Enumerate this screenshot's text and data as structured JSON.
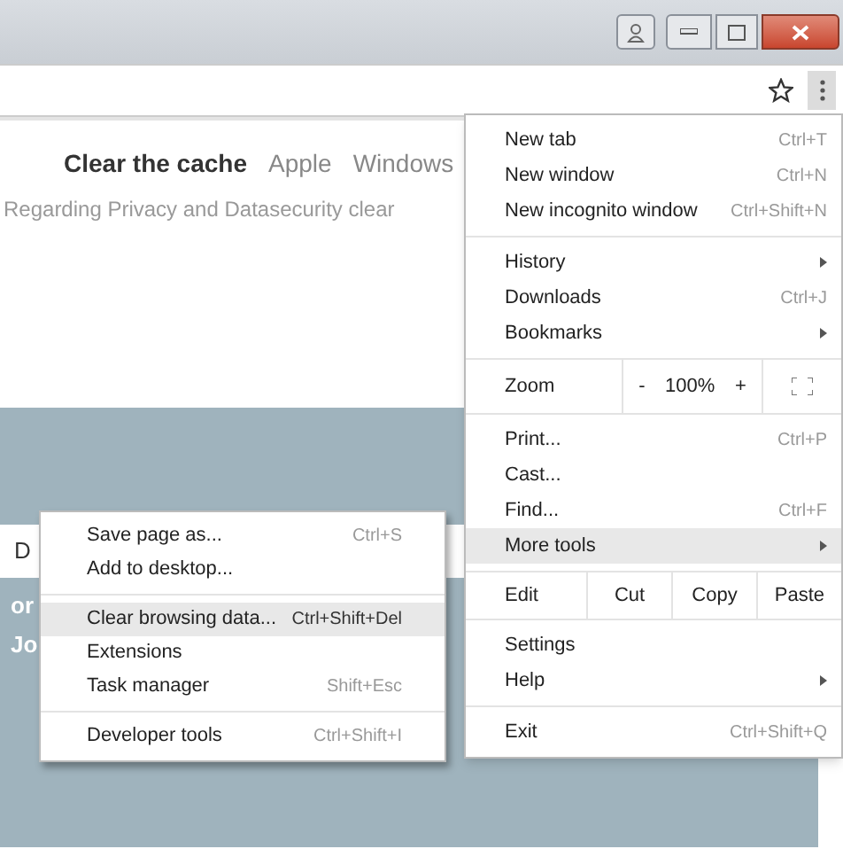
{
  "page": {
    "nav_links": [
      {
        "label": "Clear the cache",
        "selected": true
      },
      {
        "label": "Apple",
        "selected": false
      },
      {
        "label": "Windows",
        "selected": false
      }
    ],
    "subtitle": "Regarding Privacy and Datasecurity clear",
    "fragments": [
      {
        "kind": "strip",
        "text": "D"
      },
      {
        "kind": "banner",
        "text": "or"
      },
      {
        "kind": "banner",
        "text": "Jo"
      }
    ]
  },
  "menu": {
    "sections": [
      [
        {
          "kind": "item",
          "label": "New tab",
          "shortcut": "Ctrl+T",
          "submenu": false,
          "selected": false
        },
        {
          "kind": "item",
          "label": "New window",
          "shortcut": "Ctrl+N",
          "submenu": false,
          "selected": false
        },
        {
          "kind": "item",
          "label": "New incognito window",
          "shortcut": "Ctrl+Shift+N",
          "submenu": false,
          "selected": false
        }
      ],
      [
        {
          "kind": "item",
          "label": "History",
          "submenu": true,
          "selected": false
        },
        {
          "kind": "item",
          "label": "Downloads",
          "shortcut": "Ctrl+J",
          "submenu": false,
          "selected": false
        },
        {
          "kind": "item",
          "label": "Bookmarks",
          "submenu": true,
          "selected": false
        }
      ],
      [
        {
          "kind": "zoom",
          "label": "Zoom",
          "minus": "-",
          "value": "100%",
          "plus": "+"
        }
      ],
      [
        {
          "kind": "item",
          "label": "Print...",
          "shortcut": "Ctrl+P",
          "submenu": false,
          "selected": false
        },
        {
          "kind": "item",
          "label": "Cast...",
          "submenu": false,
          "selected": false
        },
        {
          "kind": "item",
          "label": "Find...",
          "shortcut": "Ctrl+F",
          "submenu": false,
          "selected": false
        },
        {
          "kind": "item",
          "label": "More tools",
          "submenu": true,
          "selected": true
        }
      ],
      [
        {
          "kind": "edit",
          "label": "Edit",
          "buttons": [
            "Cut",
            "Copy",
            "Paste"
          ]
        }
      ],
      [
        {
          "kind": "item",
          "label": "Settings",
          "submenu": false,
          "selected": false
        },
        {
          "kind": "item",
          "label": "Help",
          "submenu": true,
          "selected": false
        }
      ],
      [
        {
          "kind": "item",
          "label": "Exit",
          "shortcut": "Ctrl+Shift+Q",
          "submenu": false,
          "selected": false
        }
      ]
    ]
  },
  "submenu": {
    "sections": [
      [
        {
          "label": "Save page as...",
          "shortcut": "Ctrl+S",
          "selected": false
        },
        {
          "label": "Add to desktop...",
          "selected": false
        }
      ],
      [
        {
          "label": "Clear browsing data...",
          "shortcut": "Ctrl+Shift+Del",
          "selected": true
        },
        {
          "label": "Extensions",
          "selected": false
        },
        {
          "label": "Task manager",
          "shortcut": "Shift+Esc",
          "selected": false
        }
      ],
      [
        {
          "label": "Developer tools",
          "shortcut": "Ctrl+Shift+I",
          "selected": false
        }
      ]
    ]
  }
}
